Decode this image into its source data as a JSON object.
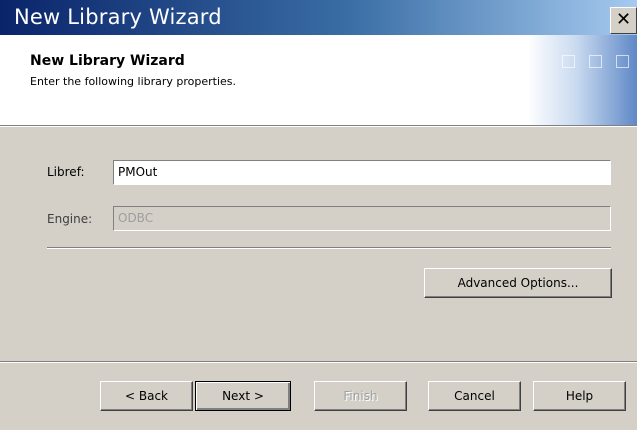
{
  "window": {
    "title": "New Library Wizard",
    "close_glyph": "✕"
  },
  "header": {
    "title": "New Library Wizard",
    "subtitle": "Enter the following library properties."
  },
  "form": {
    "libref_label": "Libref:",
    "libref_value": "PMOut",
    "engine_label": "Engine:",
    "engine_value": "ODBC"
  },
  "buttons": {
    "advanced": "Advanced Options...",
    "back": "< Back",
    "next": "Next >",
    "finish": "Finish",
    "cancel": "Cancel",
    "help": "Help"
  }
}
